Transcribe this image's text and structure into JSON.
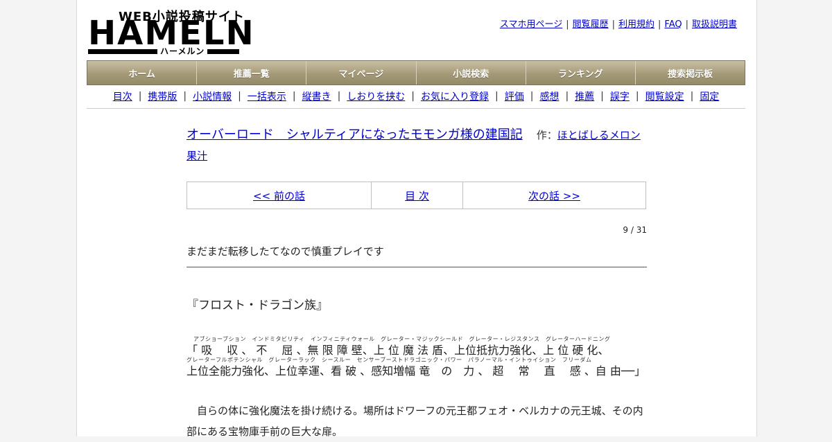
{
  "logo": {
    "top_text": "WEB小説投稿サイト",
    "main_text": "HAMELN",
    "sub_text": "ハーメルン"
  },
  "top_links": [
    "スマホ用ページ",
    "閲覧履歴",
    "利用規約",
    "FAQ",
    "取扱説明書"
  ],
  "main_nav": [
    "ホーム",
    "推薦一覧",
    "マイページ",
    "小説検索",
    "ランキング",
    "捜索掲示板"
  ],
  "sub_nav": [
    "目次",
    "携帯版",
    "小説情報",
    "一括表示",
    "縦書き",
    "しおりを挟む",
    "お気に入り登録",
    "評価",
    "感想",
    "推薦",
    "誤字",
    "閲覧設定",
    "固定"
  ],
  "novel": {
    "title": "オーバーロード　シャルティアになったモモンガ様の建国記",
    "author_label": "作：",
    "author": "ほとばしるメロン果汁"
  },
  "episode_nav": {
    "prev": "<< 前の話",
    "index": "目 次",
    "next": "次の話 >>"
  },
  "episode_count": "9 / 31",
  "episode_subtitle": "まだまだ転移したてなので慎重プレイです",
  "text": {
    "line1": "『フロスト・ドラゴン族』",
    "ruby1": "アブショーブション　インドミタビリティ　インフィニティウォール　グレーター・マジックシールド　グレーター・レジスタンス　グレーターハードニング",
    "base1": "「 吸　 収 、 不　 屈 、無 限 障 壁、上 位 魔 法 盾、上位抵抗力強化、上 位 硬 化、",
    "ruby2": "グレーターフルポテンシャル　グレーターラック　シースルー　センサーブーストドラゴニック・パワー　パラノーマル・イントゥイション　フリーダム",
    "base2": "上位全能力強化、上位幸運、看 破 、感知増幅 竜　の　力 、 超　 常　 直　 感 、自 由──」",
    "para": "　自らの体に強化魔法を掛け続ける。場所はドワーフの元王都フェオ・ベルカナの元王城、その内部にある宝物庫手前の巨大な扉。"
  }
}
